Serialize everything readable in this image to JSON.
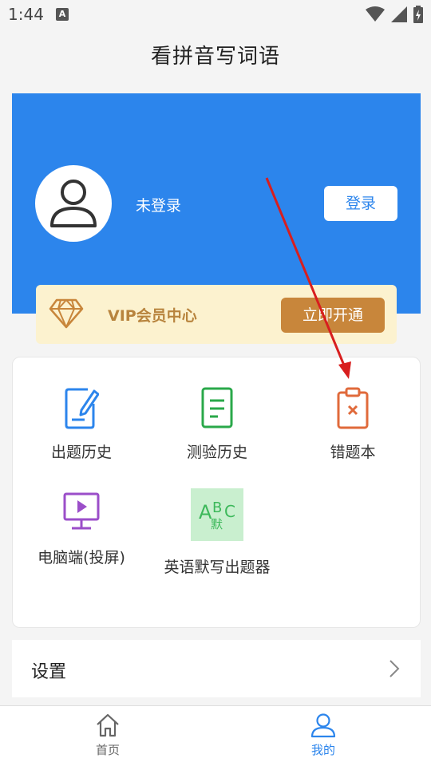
{
  "status_bar": {
    "time": "1:44",
    "badge": "A"
  },
  "header": {
    "title": "看拼音写词语"
  },
  "profile": {
    "status": "未登录",
    "login_label": "登录"
  },
  "vip": {
    "label": "VIP会员中心",
    "button_label": "立即开通"
  },
  "functions": [
    {
      "label": "出题历史",
      "icon": "edit-document-icon",
      "color": "#2c85ec"
    },
    {
      "label": "测验历史",
      "icon": "document-list-icon",
      "color": "#2aa84a"
    },
    {
      "label": "错题本",
      "icon": "clipboard-x-icon",
      "color": "#e06a3b"
    },
    {
      "label": "电脑端(投屏)",
      "icon": "monitor-play-icon",
      "color": "#9b4ec9"
    },
    {
      "label": "英语默写出题器",
      "icon": "abc-dictation-icon",
      "icon_text_1": "A",
      "icon_text_2": "B",
      "icon_text_3": "C",
      "icon_text_4": "默",
      "color": "#3cb85a"
    }
  ],
  "settings": {
    "label": "设置"
  },
  "bottom_nav": {
    "home_label": "首页",
    "mine_label": "我的",
    "active_color": "#2c85ec",
    "inactive_color": "#666666"
  }
}
